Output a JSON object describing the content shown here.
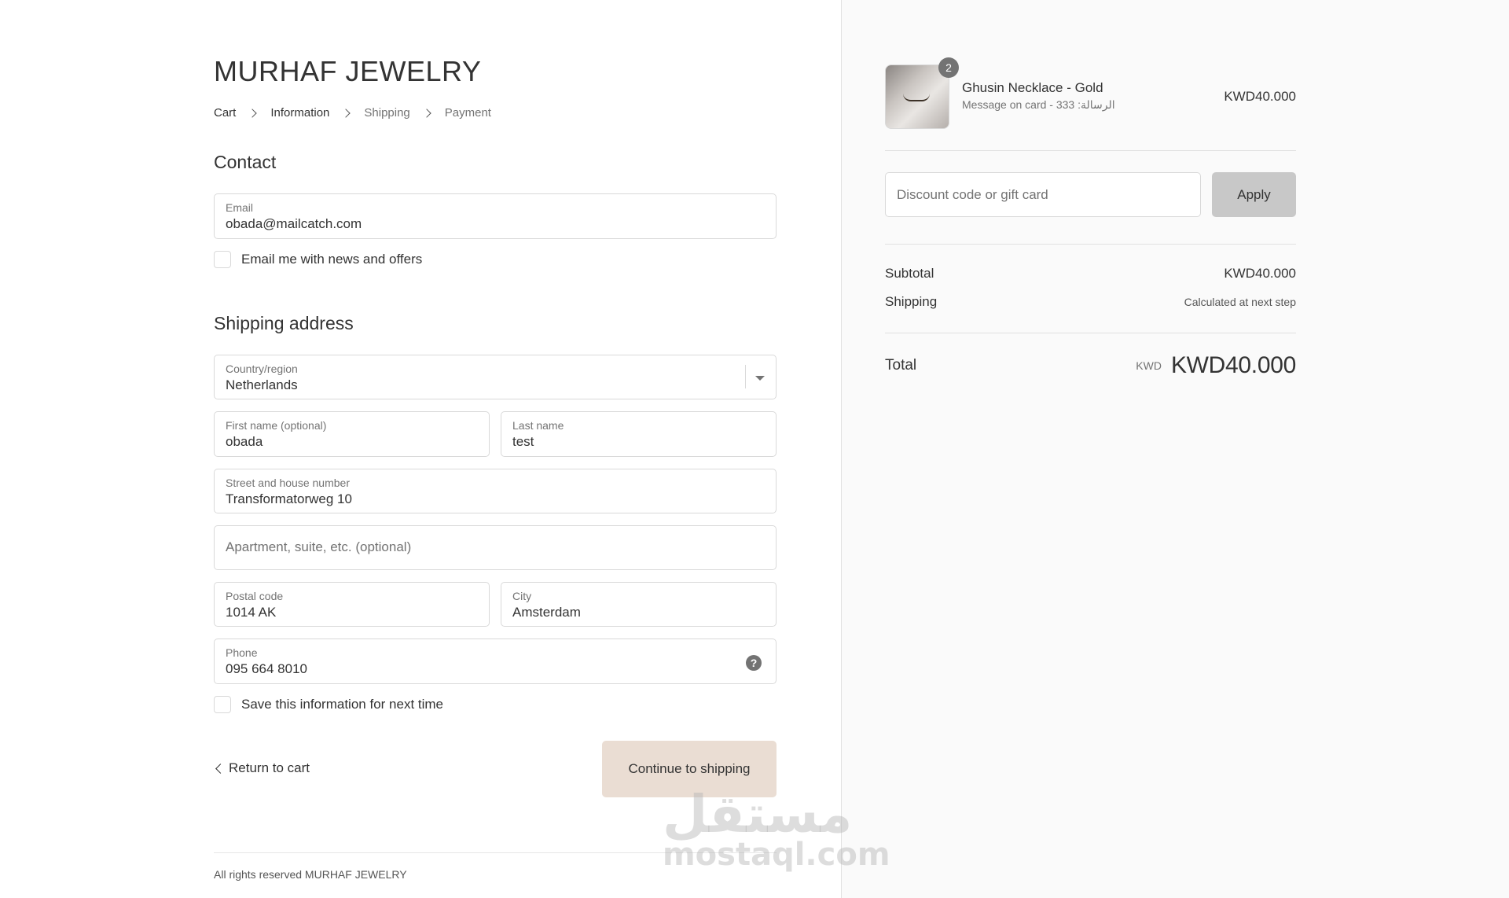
{
  "store": {
    "name": "MURHAF JEWELRY"
  },
  "breadcrumb": [
    {
      "label": "Cart"
    },
    {
      "label": "Information"
    },
    {
      "label": "Shipping"
    },
    {
      "label": "Payment"
    }
  ],
  "contact": {
    "title": "Contact",
    "email": {
      "label": "Email",
      "value": "obada@mailcatch.com"
    },
    "newsletter_label": "Email me with news and offers"
  },
  "shipping": {
    "title": "Shipping address",
    "country": {
      "label": "Country/region",
      "value": "Netherlands"
    },
    "first_name": {
      "label": "First name (optional)",
      "value": "obada"
    },
    "last_name": {
      "label": "Last name",
      "value": "test"
    },
    "street": {
      "label": "Street and house number",
      "value": "Transformatorweg 10"
    },
    "apartment": {
      "placeholder": "Apartment, suite, etc. (optional)"
    },
    "postal": {
      "label": "Postal code",
      "value": "1014 AK"
    },
    "city": {
      "label": "City",
      "value": "Amsterdam"
    },
    "phone": {
      "label": "Phone",
      "value": "095 664 8010",
      "help_glyph": "?"
    },
    "save_info_label": "Save this information for next time"
  },
  "actions": {
    "return_label": "Return to cart",
    "continue_label": "Continue to shipping"
  },
  "footer": {
    "text": "All rights reserved MURHAF JEWELRY"
  },
  "watermark": {
    "arabic": "مستقل",
    "latin": "mostaql.com"
  },
  "order": {
    "item": {
      "name": "Ghusin Necklace - Gold",
      "variant": "Message on card - 333 :الرسالة",
      "quantity": "2",
      "price": "KWD40.000"
    },
    "discount": {
      "placeholder": "Discount code or gift card",
      "apply_label": "Apply"
    },
    "subtotal": {
      "label": "Subtotal",
      "value": "KWD40.000"
    },
    "shipping": {
      "label": "Shipping",
      "value": "Calculated at next step"
    },
    "total": {
      "label": "Total",
      "currency": "KWD",
      "value": "KWD40.000"
    }
  },
  "colors": {
    "continue_button": "#eaddd3",
    "apply_button": "#c8c8c8",
    "sidebar_bg": "#fafafa"
  }
}
